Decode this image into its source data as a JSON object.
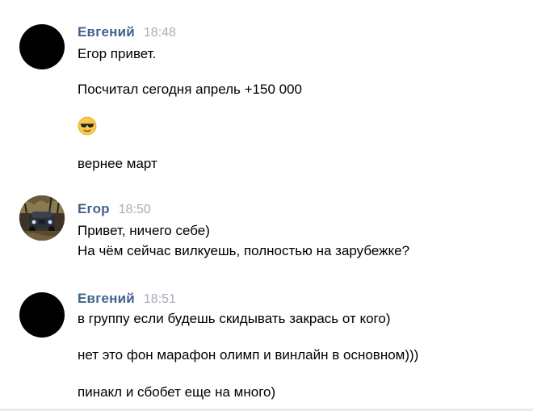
{
  "messages": [
    {
      "author": "Евгений",
      "time": "18:48",
      "avatar_icon": "user-avatar",
      "lines": [
        "Егор привет.",
        "Посчитал сегодня апрель +150 000"
      ],
      "emoji": "sunglasses-emoji",
      "after_emoji": "вернее март"
    },
    {
      "author": "Егор",
      "time": "18:50",
      "avatar_icon": "user-avatar-photo",
      "lines": [
        "Привет, ничего себе)",
        "На чём сейчас вилкуешь, полностью на зарубежке?"
      ]
    },
    {
      "author": "Евгений",
      "time": "18:51",
      "avatar_icon": "user-avatar",
      "lines": [
        "в группу если будешь скидывать закрась от кого)",
        "нет это фон марафон олимп и винлайн в основном)))",
        "пинакл и сбобет еще на много)"
      ]
    }
  ],
  "colors": {
    "author": "#42648b",
    "time": "#a6aeb8",
    "text": "#000000",
    "background": "#ffffff"
  }
}
